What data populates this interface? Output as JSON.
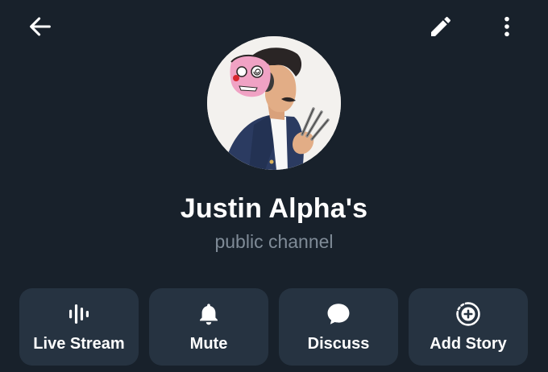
{
  "header": {
    "back_icon": "arrow-left-icon",
    "edit_icon": "pencil-icon",
    "more_icon": "more-vertical-icon"
  },
  "profile": {
    "avatar_icon": "channel-avatar",
    "name": "Justin Alpha's",
    "subtitle": "public channel"
  },
  "actions": [
    {
      "label": "Live Stream",
      "icon": "live-stream-icon"
    },
    {
      "label": "Mute",
      "icon": "bell-icon"
    },
    {
      "label": "Discuss",
      "icon": "chat-bubble-icon"
    },
    {
      "label": "Add Story",
      "icon": "add-story-icon"
    }
  ],
  "colors": {
    "background": "#18212b",
    "button_bg": "#263341",
    "text": "#ffffff",
    "subtitle": "#7f8b97"
  }
}
